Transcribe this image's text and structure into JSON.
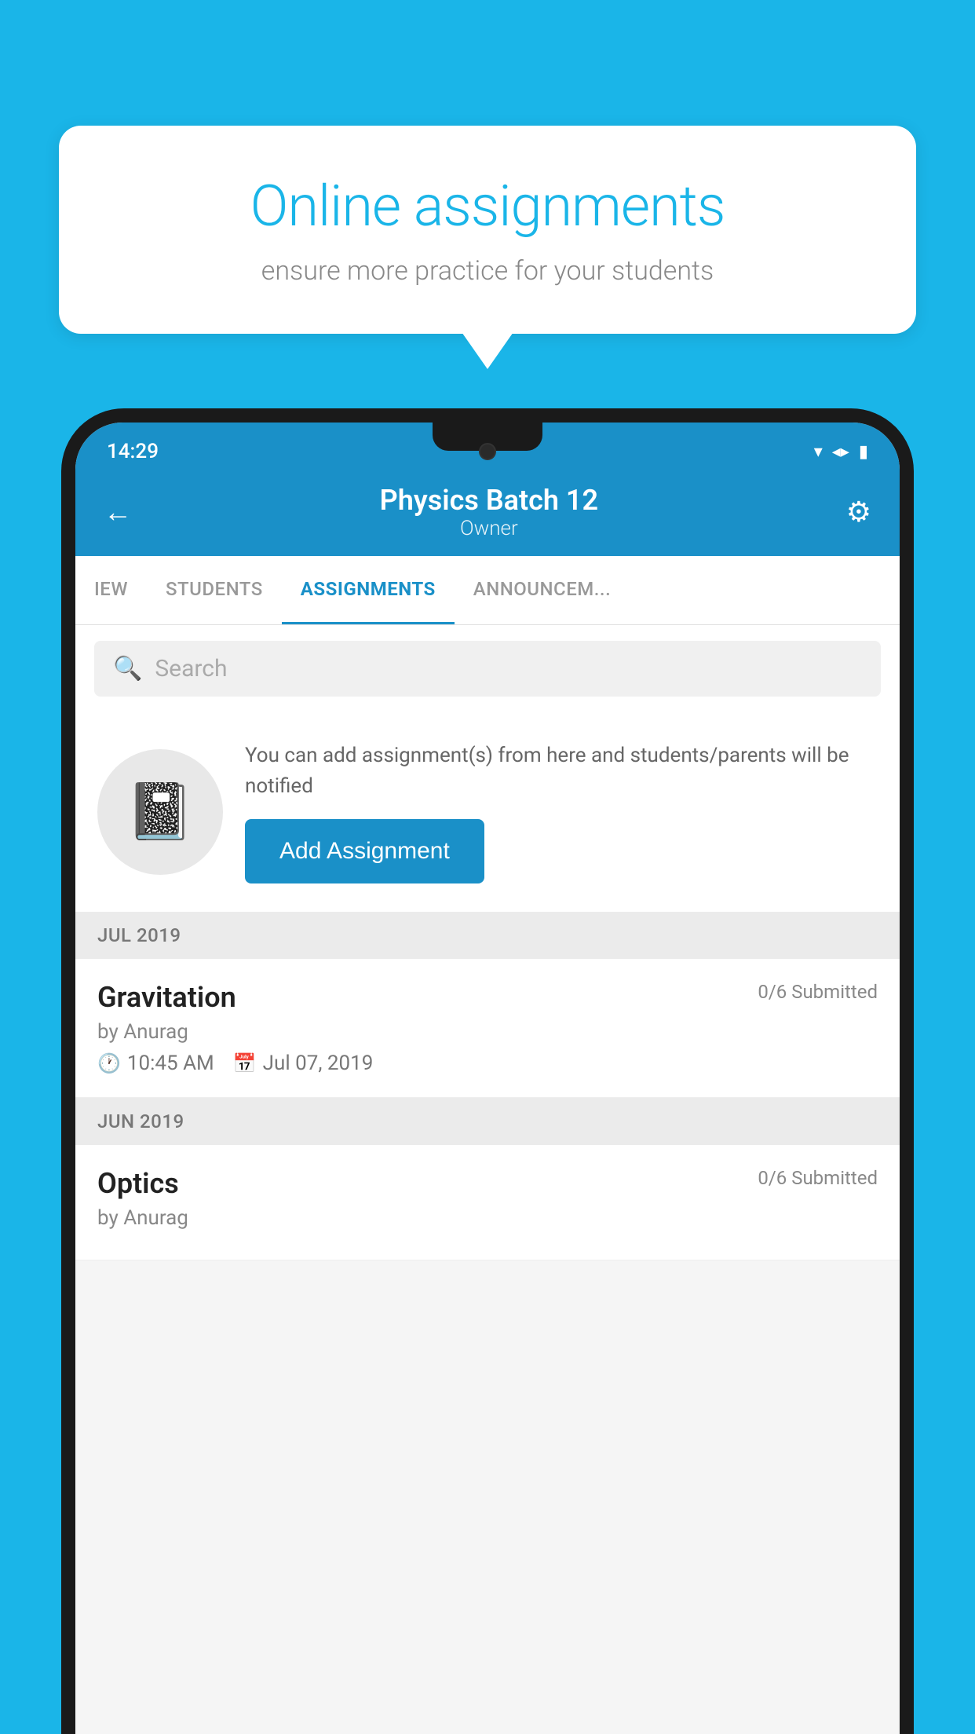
{
  "background": {
    "color": "#1ab5e8"
  },
  "speech_bubble": {
    "title": "Online assignments",
    "subtitle": "ensure more practice for your students"
  },
  "status_bar": {
    "time": "14:29",
    "wifi": "▾",
    "signal": "▲",
    "battery": "▮"
  },
  "header": {
    "title": "Physics Batch 12",
    "subtitle": "Owner",
    "back_label": "←",
    "settings_label": "⚙"
  },
  "tabs": [
    {
      "label": "IEW",
      "active": false
    },
    {
      "label": "STUDENTS",
      "active": false
    },
    {
      "label": "ASSIGNMENTS",
      "active": true
    },
    {
      "label": "ANNOUNCEM...",
      "active": false
    }
  ],
  "search": {
    "placeholder": "Search"
  },
  "add_assignment_section": {
    "description": "You can add assignment(s) from here and students/parents will be notified",
    "button_label": "Add Assignment"
  },
  "months": [
    {
      "label": "JUL 2019",
      "assignments": [
        {
          "name": "Gravitation",
          "submitted": "0/6 Submitted",
          "author": "by Anurag",
          "time": "10:45 AM",
          "date": "Jul 07, 2019"
        }
      ]
    },
    {
      "label": "JUN 2019",
      "assignments": [
        {
          "name": "Optics",
          "submitted": "0/6 Submitted",
          "author": "by Anurag",
          "time": "",
          "date": ""
        }
      ]
    }
  ]
}
